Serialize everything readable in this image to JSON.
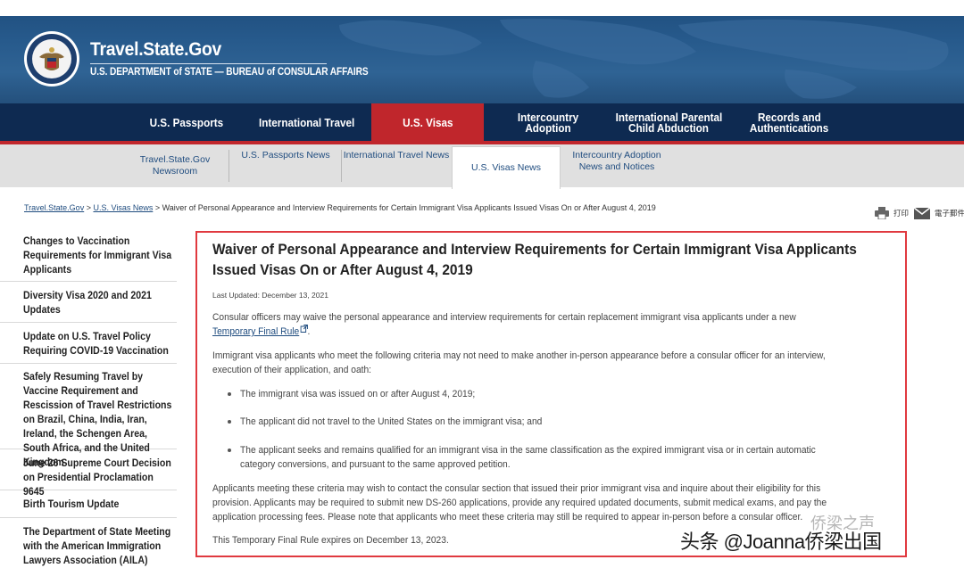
{
  "header": {
    "title": "Travel.State.Gov",
    "subtitle": "U.S. DEPARTMENT of STATE — BUREAU of CONSULAR AFFAIRS"
  },
  "mainnav": {
    "tabs": [
      {
        "label": "U.S. Passports"
      },
      {
        "label": "International Travel"
      },
      {
        "label": "U.S. Visas",
        "active": true
      },
      {
        "label": "Intercountry Adoption"
      },
      {
        "label1": "International Parental",
        "label2": "Child Abduction"
      },
      {
        "label1": "Records and",
        "label2": "Authentications"
      }
    ]
  },
  "subnav": {
    "items": [
      {
        "label1": "Travel.State.Gov",
        "label2": "Newsroom"
      },
      {
        "label1": "U.S. Passports News"
      },
      {
        "label1": "International Travel News"
      },
      {
        "label1": "U.S. Visas News",
        "active": true
      },
      {
        "label1": "Intercountry Adoption",
        "label2": "News and Notices"
      }
    ]
  },
  "breadcrumb": {
    "home": "Travel.State.Gov",
    "sep": " > ",
    "section": "U.S. Visas News",
    "current": "Waiver of Personal Appearance and Interview Requirements for Certain Immigrant Visa Applicants Issued Visas On or After August 4, 2019"
  },
  "tools": {
    "print": "打印",
    "email": "電子郵件"
  },
  "sidebar": {
    "items": [
      {
        "label": "Changes to Vaccination Requirements for Immigrant Visa Applicants"
      },
      {
        "label": "Diversity Visa 2020 and 2021 Updates"
      },
      {
        "label": "Update on U.S. Travel Policy Requiring COVID-19 Vaccination"
      },
      {
        "label": "Safely Resuming Travel by Vaccine Requirement and Rescission of Travel Restrictions on Brazil, China, India, Iran, Ireland, the Schengen Area, South Africa, and the United Kingdom"
      },
      {
        "label": "June 26 Supreme Court Decision on Presidential Proclamation 9645"
      },
      {
        "label": "Birth Tourism Update"
      },
      {
        "label": "The Department of State Meeting with the American Immigration Lawyers Association (AILA)"
      }
    ]
  },
  "article": {
    "title": "Waiver of Personal Appearance and Interview Requirements for Certain Immigrant Visa Applicants Issued Visas On or After August 4, 2019",
    "updated": "Last Updated: December 13, 2021",
    "p1": "Consular officers may waive the personal appearance and interview requirements for certain replacement immigrant visa applicants under a new",
    "p1_link": "Temporary Final Rule",
    "p1_end": ".",
    "p2": "Immigrant visa applicants who meet the following criteria may not need to make another in-person appearance before a consular officer for an interview, execution of their application, and oath:",
    "bullets": [
      "The immigrant visa was issued on or after August 4, 2019;",
      "The applicant did not travel to the United States on the immigrant visa; and",
      "The applicant seeks and remains qualified for an immigrant visa in the same classification as the expired immigrant visa or in certain automatic category conversions, and pursuant to the same approved petition."
    ],
    "p3": "Applicants meeting these criteria may wish to contact the consular section that issued their prior immigrant visa and inquire about their eligibility for this provision. Applicants may be required to submit new DS-260 applications, provide any required updated documents, submit medical exams, and pay the application processing fees. Please note that applicants who meet these criteria may still be required to appear in-person before a consular officer.",
    "p4": "This Temporary Final Rule expires on December 13, 2023."
  },
  "watermarks": {
    "wechat": "侨梁之声",
    "toutiao": "头条 @Joanna侨梁出国"
  }
}
